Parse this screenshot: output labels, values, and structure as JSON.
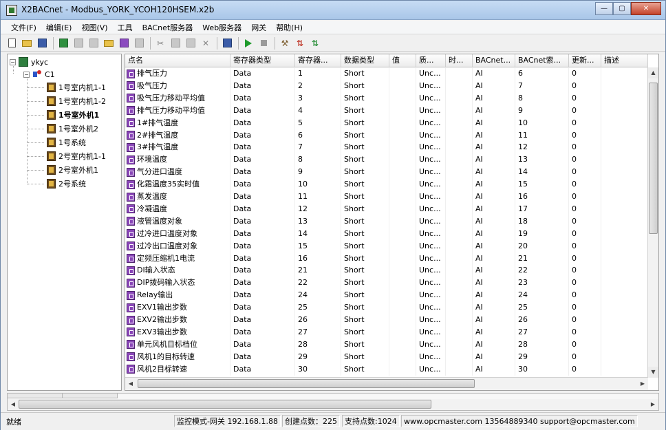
{
  "window": {
    "title": "X2BACnet - Modbus_YORK_YCOH120HSEM.x2b",
    "minimize_glyph": "—",
    "maximize_glyph": "▢",
    "close_glyph": "✕"
  },
  "menu": [
    {
      "label": "文件(F)"
    },
    {
      "label": "编辑(E)"
    },
    {
      "label": "视图(V)"
    },
    {
      "label": "工具"
    },
    {
      "label": "BACnet服务器"
    },
    {
      "label": "Web服务器"
    },
    {
      "label": "网关"
    },
    {
      "label": "帮助(H)"
    }
  ],
  "toolbar_icons": [
    "new-file-icon",
    "open-folder-icon",
    "save-icon",
    "add-project-icon",
    "add-channel-icon",
    "add-device-icon",
    "add-group-icon",
    "add-point-icon",
    "cut-icon",
    "copy-icon",
    "paste-icon",
    "delete-icon",
    "find-icon",
    "start-icon",
    "stop-icon",
    "tools-icon",
    "gateway-config-icon",
    "gateway-run-icon"
  ],
  "tree": {
    "project": "ykyc",
    "channel": "C1",
    "devices": [
      {
        "label": "1号室内机1-1",
        "bold": false
      },
      {
        "label": "1号室内机1-2",
        "bold": false
      },
      {
        "label": "1号室外机1",
        "bold": true
      },
      {
        "label": "1号室外机2",
        "bold": false
      },
      {
        "label": "1号系统",
        "bold": false
      },
      {
        "label": "2号室内机1-1",
        "bold": false
      },
      {
        "label": "2号室外机1",
        "bold": false
      },
      {
        "label": "2号系统",
        "bold": false
      }
    ]
  },
  "grid": {
    "columns": [
      "点名",
      "寄存器类型",
      "寄存器...",
      "数据类型",
      "值",
      "质...",
      "时...",
      "BACnet...",
      "BACnet索...",
      "更新...",
      "描述"
    ],
    "rows": [
      [
        "排气压力",
        "Data",
        "1",
        "Short",
        "",
        "Unc...",
        "",
        "AI",
        "6",
        "0",
        ""
      ],
      [
        "吸气压力",
        "Data",
        "2",
        "Short",
        "",
        "Unc...",
        "",
        "AI",
        "7",
        "0",
        ""
      ],
      [
        "吸气压力移动平均值",
        "Data",
        "3",
        "Short",
        "",
        "Unc...",
        "",
        "AI",
        "8",
        "0",
        ""
      ],
      [
        "排气压力移动平均值",
        "Data",
        "4",
        "Short",
        "",
        "Unc...",
        "",
        "AI",
        "9",
        "0",
        ""
      ],
      [
        "1#排气温度",
        "Data",
        "5",
        "Short",
        "",
        "Unc...",
        "",
        "AI",
        "10",
        "0",
        ""
      ],
      [
        "2#排气温度",
        "Data",
        "6",
        "Short",
        "",
        "Unc...",
        "",
        "AI",
        "11",
        "0",
        ""
      ],
      [
        "3#排气温度",
        "Data",
        "7",
        "Short",
        "",
        "Unc...",
        "",
        "AI",
        "12",
        "0",
        ""
      ],
      [
        "环境温度",
        "Data",
        "8",
        "Short",
        "",
        "Unc...",
        "",
        "AI",
        "13",
        "0",
        ""
      ],
      [
        "气分进口温度",
        "Data",
        "9",
        "Short",
        "",
        "Unc...",
        "",
        "AI",
        "14",
        "0",
        ""
      ],
      [
        "化霜温度35实时值",
        "Data",
        "10",
        "Short",
        "",
        "Unc...",
        "",
        "AI",
        "15",
        "0",
        ""
      ],
      [
        "蒸发温度",
        "Data",
        "11",
        "Short",
        "",
        "Unc...",
        "",
        "AI",
        "16",
        "0",
        ""
      ],
      [
        "冷凝温度",
        "Data",
        "12",
        "Short",
        "",
        "Unc...",
        "",
        "AI",
        "17",
        "0",
        ""
      ],
      [
        "液管温度对象",
        "Data",
        "13",
        "Short",
        "",
        "Unc...",
        "",
        "AI",
        "18",
        "0",
        ""
      ],
      [
        "过冷进口温度对象",
        "Data",
        "14",
        "Short",
        "",
        "Unc...",
        "",
        "AI",
        "19",
        "0",
        ""
      ],
      [
        "过冷出口温度对象",
        "Data",
        "15",
        "Short",
        "",
        "Unc...",
        "",
        "AI",
        "20",
        "0",
        ""
      ],
      [
        "定频压缩机1电流",
        "Data",
        "16",
        "Short",
        "",
        "Unc...",
        "",
        "AI",
        "21",
        "0",
        ""
      ],
      [
        "DI输入状态",
        "Data",
        "21",
        "Short",
        "",
        "Unc...",
        "",
        "AI",
        "22",
        "0",
        ""
      ],
      [
        "DIP拨码输入状态",
        "Data",
        "22",
        "Short",
        "",
        "Unc...",
        "",
        "AI",
        "23",
        "0",
        ""
      ],
      [
        "Relay输出",
        "Data",
        "24",
        "Short",
        "",
        "Unc...",
        "",
        "AI",
        "24",
        "0",
        ""
      ],
      [
        "EXV1输出步数",
        "Data",
        "25",
        "Short",
        "",
        "Unc...",
        "",
        "AI",
        "25",
        "0",
        ""
      ],
      [
        "EXV2输出步数",
        "Data",
        "26",
        "Short",
        "",
        "Unc...",
        "",
        "AI",
        "26",
        "0",
        ""
      ],
      [
        "EXV3输出步数",
        "Data",
        "27",
        "Short",
        "",
        "Unc...",
        "",
        "AI",
        "27",
        "0",
        ""
      ],
      [
        "单元风机目标档位",
        "Data",
        "28",
        "Short",
        "",
        "Unc...",
        "",
        "AI",
        "28",
        "0",
        ""
      ],
      [
        "风机1的目标转速",
        "Data",
        "29",
        "Short",
        "",
        "Unc...",
        "",
        "AI",
        "29",
        "0",
        ""
      ],
      [
        "风机2目标转速",
        "Data",
        "30",
        "Short",
        "",
        "Unc...",
        "",
        "AI",
        "30",
        "0",
        ""
      ]
    ]
  },
  "status": {
    "ready": "就绪",
    "mode": "监控模式-网关 192.168.1.88",
    "created": "创建点数：225",
    "supported": "支持点数:1024",
    "contact": "www.opcmaster.com 13564889340 support@opcmaster.com"
  },
  "colors": {
    "point_icon": "#8a47b8",
    "title_gradient_top": "#c7dcf4",
    "close_button": "#c4432a"
  }
}
